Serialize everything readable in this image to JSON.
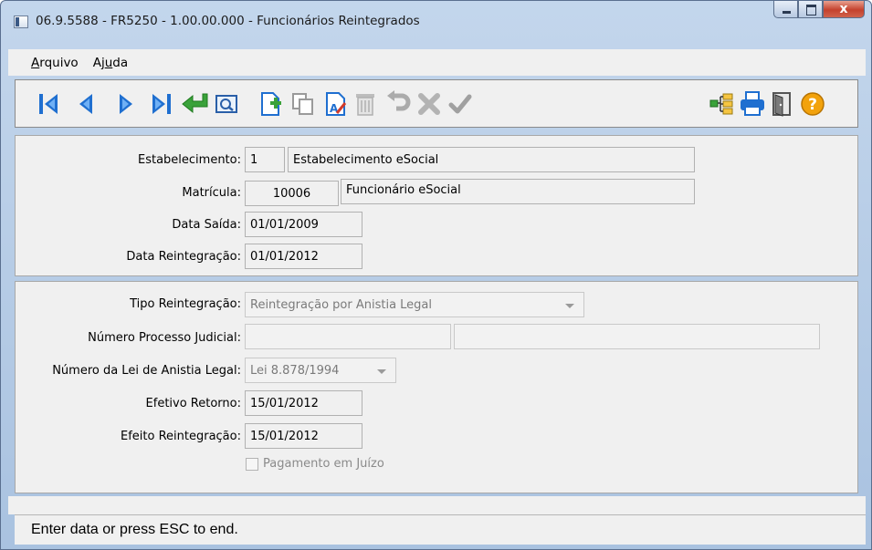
{
  "window": {
    "title": "06.9.5588 - FR5250 - 1.00.00.000 - Funcionários Reintegrados",
    "close_glyph": "x"
  },
  "menu": {
    "arquivo_first": "A",
    "arquivo_rest": "rquivo",
    "ajuda_first": "Aj",
    "ajuda_underlined": "u",
    "ajuda_rest": "da"
  },
  "toolbar": {
    "icons": [
      "first-icon",
      "previous-icon",
      "next-icon",
      "last-icon",
      "goto-icon",
      "search-icon",
      "add-icon",
      "copy-icon",
      "edit-icon",
      "delete-icon",
      "undo-icon",
      "cancel-icon",
      "save-icon",
      "query-icon",
      "print-icon",
      "exit-icon",
      "help-icon"
    ],
    "colors": {
      "blue": "#1f6fd0",
      "green": "#3aa23a",
      "gray": "#a8a8a8",
      "orange": "#f2a20c"
    }
  },
  "form": {
    "estabelecimento": {
      "label": "Estabelecimento:",
      "code": "1",
      "name": "Estabelecimento eSocial"
    },
    "matricula": {
      "label": "Matrícula:",
      "code": "10006",
      "name": "Funcionário eSocial"
    },
    "data_saida": {
      "label": "Data Saída:",
      "value": "01/01/2009"
    },
    "data_reintegracao": {
      "label": "Data Reintegração:",
      "value": "01/01/2012"
    },
    "tipo_reintegracao": {
      "label": "Tipo Reintegração:",
      "value": "Reintegração por Anistia Legal"
    },
    "numero_processo": {
      "label": "Número Processo Judicial:",
      "value1": "",
      "value2": ""
    },
    "numero_lei": {
      "label": "Número da Lei de Anistia Legal:",
      "value": "Lei 8.878/1994"
    },
    "efetivo_retorno": {
      "label": "Efetivo Retorno:",
      "value": "15/01/2012"
    },
    "efeito_reintegracao": {
      "label": "Efeito Reintegração:",
      "value": "15/01/2012"
    },
    "pagamento_juizo": {
      "label": "Pagamento em Juízo",
      "checked": false
    }
  },
  "status": {
    "text": "Enter data or press ESC to end."
  }
}
